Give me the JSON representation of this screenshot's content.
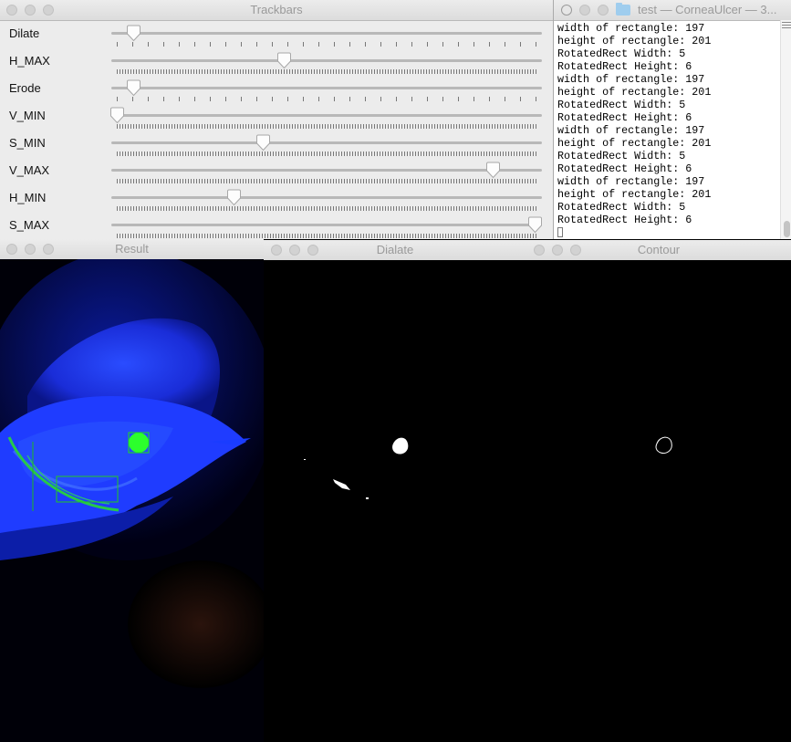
{
  "trackbars": {
    "title": "Trackbars",
    "rows": [
      {
        "label": "Dilate",
        "value_fraction": 0.04,
        "ticks": "coarse"
      },
      {
        "label": "H_MAX",
        "value_fraction": 0.4,
        "ticks": "fine"
      },
      {
        "label": "Erode",
        "value_fraction": 0.04,
        "ticks": "coarse"
      },
      {
        "label": "V_MIN",
        "value_fraction": 0.0,
        "ticks": "fine"
      },
      {
        "label": "S_MIN",
        "value_fraction": 0.35,
        "ticks": "fine"
      },
      {
        "label": "V_MAX",
        "value_fraction": 0.9,
        "ticks": "fine"
      },
      {
        "label": "H_MIN",
        "value_fraction": 0.28,
        "ticks": "fine"
      },
      {
        "label": "S_MAX",
        "value_fraction": 1.0,
        "ticks": "fine"
      }
    ]
  },
  "terminal": {
    "title": "test — CorneaUlcer — 3...",
    "lines": [
      "width of rectangle: 197",
      "height of rectangle: 201",
      "RotatedRect Width: 5",
      "RotatedRect Height: 6",
      "width of rectangle: 197",
      "height of rectangle: 201",
      "RotatedRect Width: 5",
      "RotatedRect Height: 6",
      "width of rectangle: 197",
      "height of rectangle: 201",
      "RotatedRect Width: 5",
      "RotatedRect Height: 6",
      "width of rectangle: 197",
      "height of rectangle: 201",
      "RotatedRect Width: 5",
      "RotatedRect Height: 6"
    ]
  },
  "windows": {
    "result_title": "Result",
    "dialate_title": "Dialate",
    "contour_title": "Contour"
  },
  "colors": {
    "eye_blue": "#1a2dff",
    "stain_green": "#2cff2c",
    "mask_white": "#ffffff"
  }
}
